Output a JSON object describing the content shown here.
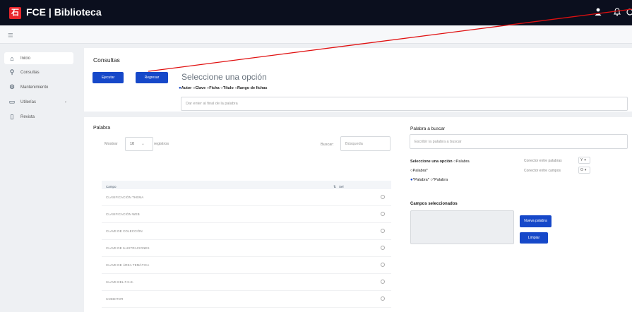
{
  "topbar": {
    "logo_text": "石",
    "title": "FCE | Biblioteca",
    "user_icon": "user-icon",
    "bell_icon": "bell-icon",
    "gear_icon": "gear-icon"
  },
  "sidebar": {
    "items": [
      {
        "label": "Inicio",
        "icon": "home-icon"
      },
      {
        "label": "Consultas",
        "icon": "search-icon"
      },
      {
        "label": "Mantenimiento",
        "icon": "gear-icon"
      },
      {
        "label": "Utilerías",
        "icon": "clipboard-icon"
      },
      {
        "label": "Revista",
        "icon": "document-icon"
      }
    ]
  },
  "consultas": {
    "title": "Consultas",
    "ejecutar": "Ejecutar",
    "regresar": "Regresar",
    "heading": "Seleccione una opción",
    "options": [
      "Autor",
      "Clave",
      "Ficha",
      "Título",
      "Rango de fichas"
    ],
    "input_placeholder": "Dar enter al final de la palabra"
  },
  "palabra": {
    "title": "Palabra",
    "mostrar": "Mostrar",
    "page_size": "10",
    "registros": "registros",
    "buscar": "Buscar:",
    "buscar_placeholder": "Búsqueda",
    "col_campo": "Campo",
    "col_sel": "Sel",
    "rows": [
      "CLASIFICACIÓN THEMA",
      "CLASIFICACIÓN WEB",
      "CLAVE DE COLECCIÓN",
      "CLAVE DE ILUSTRACIONES",
      "CLAVE DE ÁREA TEMÁTICA",
      "CLAVE DEL F.C.E.",
      "COEDITOR"
    ]
  },
  "palabra_buscar": {
    "title": "Palabra a buscar",
    "placeholder": "Escribir la palabra a buscar",
    "seleccione": "Seleccione una opción",
    "opt1": "Palabra",
    "opt2": "Palabra*",
    "opt3": "*Palabra*",
    "opt4": "*Palabra",
    "conector_palabras_label": "Conector entre palabras",
    "conector_palabras_value": "Y",
    "conector_campos_label": "Conector entre campos",
    "conector_campos_value": "O",
    "campos_title": "Campos seleccionados",
    "nueva_palabra": "Nueva palabra",
    "limpiar": "Limpiar"
  },
  "colors": {
    "accent": "#1648c9",
    "topbar": "#0b0f1e",
    "annotation": "#e01010"
  }
}
